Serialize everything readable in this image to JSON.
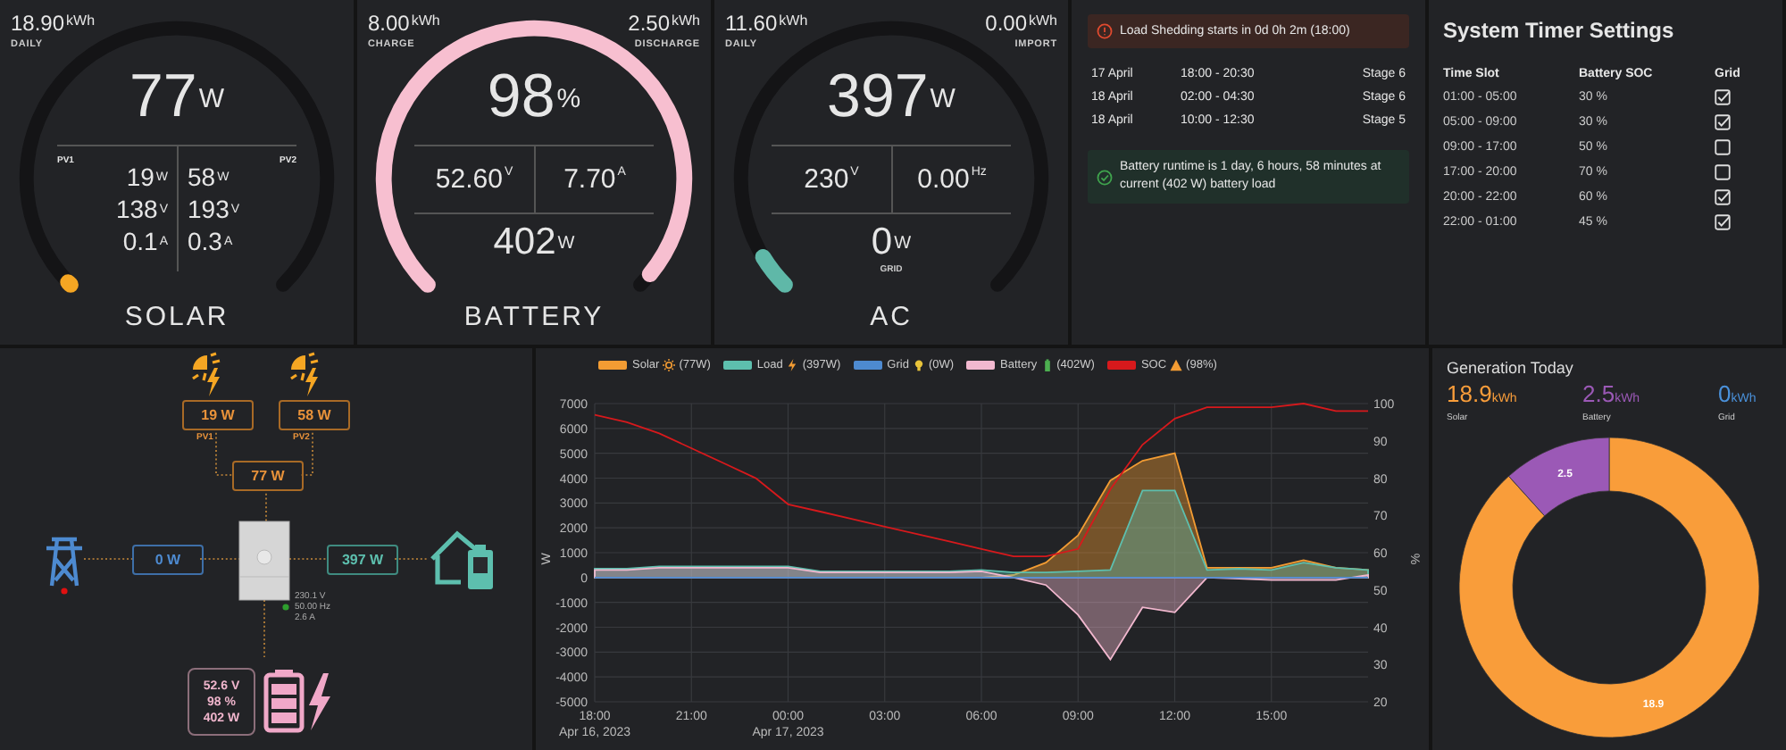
{
  "gauges": [
    {
      "kind": "solar",
      "title": "SOLAR",
      "color": "#f5a623",
      "top_left": {
        "value": "18.90",
        "unit": "kWh",
        "label": "DAILY"
      },
      "main": {
        "value": "77",
        "unit": "W"
      },
      "columns": [
        {
          "label": "PV1",
          "readings": [
            {
              "value": "19",
              "unit": "W"
            },
            {
              "value": "138",
              "unit": "V"
            },
            {
              "value": "0.1",
              "unit": "A"
            }
          ]
        },
        {
          "label": "PV2",
          "readings": [
            {
              "value": "58",
              "unit": "W"
            },
            {
              "value": "193",
              "unit": "V"
            },
            {
              "value": "0.3",
              "unit": "A"
            }
          ]
        }
      ]
    },
    {
      "kind": "battery",
      "title": "BATTERY",
      "color": "#f7bfd0",
      "top_left": {
        "value": "8.00",
        "unit": "kWh",
        "label": "CHARGE"
      },
      "top_right": {
        "value": "2.50",
        "unit": "kWh",
        "label": "DISCHARGE"
      },
      "main": {
        "value": "98",
        "unit": "%"
      },
      "cells": [
        {
          "value": "52.60",
          "unit": "V"
        },
        {
          "value": "7.70",
          "unit": "A"
        }
      ],
      "bottom": {
        "value": "402",
        "unit": "W"
      }
    },
    {
      "kind": "ac",
      "title": "AC",
      "color": "#5fb8a8",
      "top_left": {
        "value": "11.60",
        "unit": "kWh",
        "label": "DAILY"
      },
      "top_right": {
        "value": "0.00",
        "unit": "kWh",
        "label": "IMPORT"
      },
      "main": {
        "value": "397",
        "unit": "W"
      },
      "cells": [
        {
          "value": "230",
          "unit": "V"
        },
        {
          "value": "0.00",
          "unit": "Hz"
        }
      ],
      "bottom": {
        "value": "0",
        "unit": "W",
        "label": "GRID"
      }
    }
  ],
  "load_shedding": {
    "alert": "Load Shedding starts in 0d 0h 2m (18:00)",
    "schedule": [
      {
        "date": "17 April",
        "time": "18:00 - 20:30",
        "stage": "Stage 6"
      },
      {
        "date": "18 April",
        "time": "02:00 - 04:30",
        "stage": "Stage 6"
      },
      {
        "date": "18 April",
        "time": "10:00 - 12:30",
        "stage": "Stage 5"
      }
    ],
    "runtime": "Battery runtime is 1 day, 6 hours, 58 minutes at current (402 W) battery load"
  },
  "timer": {
    "title": "System Timer Settings",
    "columns": [
      "Time Slot",
      "Battery SOC",
      "Grid"
    ],
    "rows": [
      {
        "time": "01:00 - 05:00",
        "soc": "30 %",
        "checked": true
      },
      {
        "time": "05:00 - 09:00",
        "soc": "30 %",
        "checked": true
      },
      {
        "time": "09:00 - 17:00",
        "soc": "50 %",
        "checked": false
      },
      {
        "time": "17:00 - 20:00",
        "soc": "70 %",
        "checked": false
      },
      {
        "time": "20:00 - 22:00",
        "soc": "60 %",
        "checked": true
      },
      {
        "time": "22:00 - 01:00",
        "soc": "45 %",
        "checked": true
      }
    ]
  },
  "flow": {
    "pv": [
      {
        "power": "19 W",
        "label": "PV1"
      },
      {
        "power": "58 W",
        "label": "PV2"
      }
    ],
    "pv_total": "77 W",
    "grid": {
      "power": "0 W"
    },
    "load": {
      "power": "397 W"
    },
    "inverter": {
      "readings": [
        "230.1 V",
        "50.00 Hz",
        "2.6 A"
      ]
    },
    "battery": {
      "readings": [
        "52.6 V",
        "98 %",
        "402 W"
      ]
    }
  },
  "chart": {
    "legend_readings": [
      "(77W)",
      "(397W)",
      "(0W)",
      "(402W)",
      "(98%)"
    ],
    "chart_data": {
      "type": "area",
      "ylabel": "W",
      "y2label": "%",
      "ylim": [
        -5000,
        7000
      ],
      "y2lim": [
        20,
        100
      ],
      "categories": [
        "18:00",
        null,
        null,
        "21:00",
        null,
        null,
        "00:00",
        null,
        null,
        "03:00",
        null,
        null,
        "06:00",
        null,
        null,
        "09:00",
        null,
        null,
        "12:00",
        null,
        null,
        "15:00",
        null,
        null,
        null
      ],
      "annotations": [
        "Apr 16, 2023",
        "Apr 17, 2023"
      ],
      "grid": true,
      "legend": true,
      "yticks": [
        -5000,
        -4000,
        -3000,
        -2000,
        -1000,
        0,
        1000,
        2000,
        3000,
        4000,
        5000,
        6000,
        7000
      ],
      "y2ticks": [
        20,
        30,
        40,
        50,
        60,
        70,
        80,
        90,
        100
      ],
      "series": [
        {
          "name": "Solar",
          "type": "area",
          "color": "#f39c33",
          "values": [
            0,
            0,
            0,
            0,
            0,
            0,
            0,
            0,
            0,
            0,
            0,
            0,
            0,
            100,
            600,
            1700,
            3900,
            4700,
            5000,
            400,
            400,
            400,
            700,
            400,
            300
          ]
        },
        {
          "name": "Load",
          "type": "area",
          "color": "#5dbfae",
          "values": [
            350,
            350,
            450,
            450,
            450,
            450,
            450,
            250,
            250,
            250,
            250,
            250,
            300,
            200,
            200,
            250,
            300,
            3500,
            3500,
            300,
            350,
            300,
            600,
            400,
            300
          ]
        },
        {
          "name": "Grid",
          "type": "line",
          "color": "#4d8ad0",
          "values": [
            0,
            0,
            0,
            0,
            0,
            0,
            0,
            0,
            0,
            0,
            0,
            0,
            0,
            0,
            0,
            0,
            0,
            0,
            0,
            0,
            0,
            0,
            0,
            0,
            0
          ]
        },
        {
          "name": "Battery",
          "type": "area",
          "color": "#f2b8cf",
          "values": [
            300,
            300,
            400,
            400,
            400,
            400,
            400,
            200,
            200,
            200,
            200,
            200,
            250,
            0,
            -300,
            -1500,
            -3300,
            -1200,
            -1400,
            0,
            -50,
            -100,
            -100,
            -100,
            100
          ]
        },
        {
          "name": "SOC",
          "type": "line",
          "axis": "y2",
          "color": "#d7191c",
          "values": [
            97,
            95,
            92,
            88,
            84,
            80,
            73,
            71,
            69,
            67,
            65,
            63,
            61,
            59,
            59,
            61,
            77,
            89,
            96,
            99,
            99,
            99,
            100,
            98,
            98
          ]
        }
      ]
    }
  },
  "generation": {
    "title": "Generation Today",
    "totals": [
      {
        "value": "18.9",
        "unit": "kWh",
        "color": "#f99d3a"
      },
      {
        "value": "2.5",
        "unit": "kWh",
        "color": "#9b59b6"
      },
      {
        "value": "0",
        "unit": "kWh",
        "color": "#4a90d9"
      }
    ],
    "chart_data": {
      "type": "donut",
      "categories": [
        "Solar",
        "Battery",
        "Grid"
      ],
      "values": [
        18.9,
        2.5,
        0
      ],
      "value_labels": [
        "18.9",
        "2.5",
        null
      ]
    }
  }
}
